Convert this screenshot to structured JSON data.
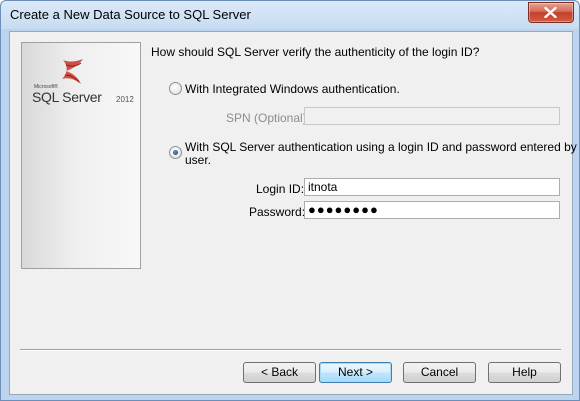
{
  "window": {
    "title": "Create a New Data Source to SQL Server"
  },
  "logo": {
    "microsoft": "Microsoft®",
    "product": "SQL Server",
    "version": "2012"
  },
  "auth": {
    "question": "How should SQL Server verify the authenticity of the login ID?",
    "windows_option": "With Integrated Windows authentication.",
    "spn_label": "SPN (Optional):",
    "spn_value": "",
    "sql_option_line1": "With SQL Server authentication using a login ID and password entered by the",
    "sql_option_line2": "user.",
    "selected": "sql"
  },
  "credentials": {
    "login_label": "Login ID:",
    "login_value": "itnota",
    "password_label": "Password:",
    "password_mask": "●●●●●●●●"
  },
  "buttons": {
    "back": "< Back",
    "next": "Next >",
    "cancel": "Cancel",
    "help": "Help"
  },
  "colors": {
    "titlebar": "#c7dcf2",
    "close": "#c2412a",
    "dialog_bg": "#f0f0f0"
  }
}
